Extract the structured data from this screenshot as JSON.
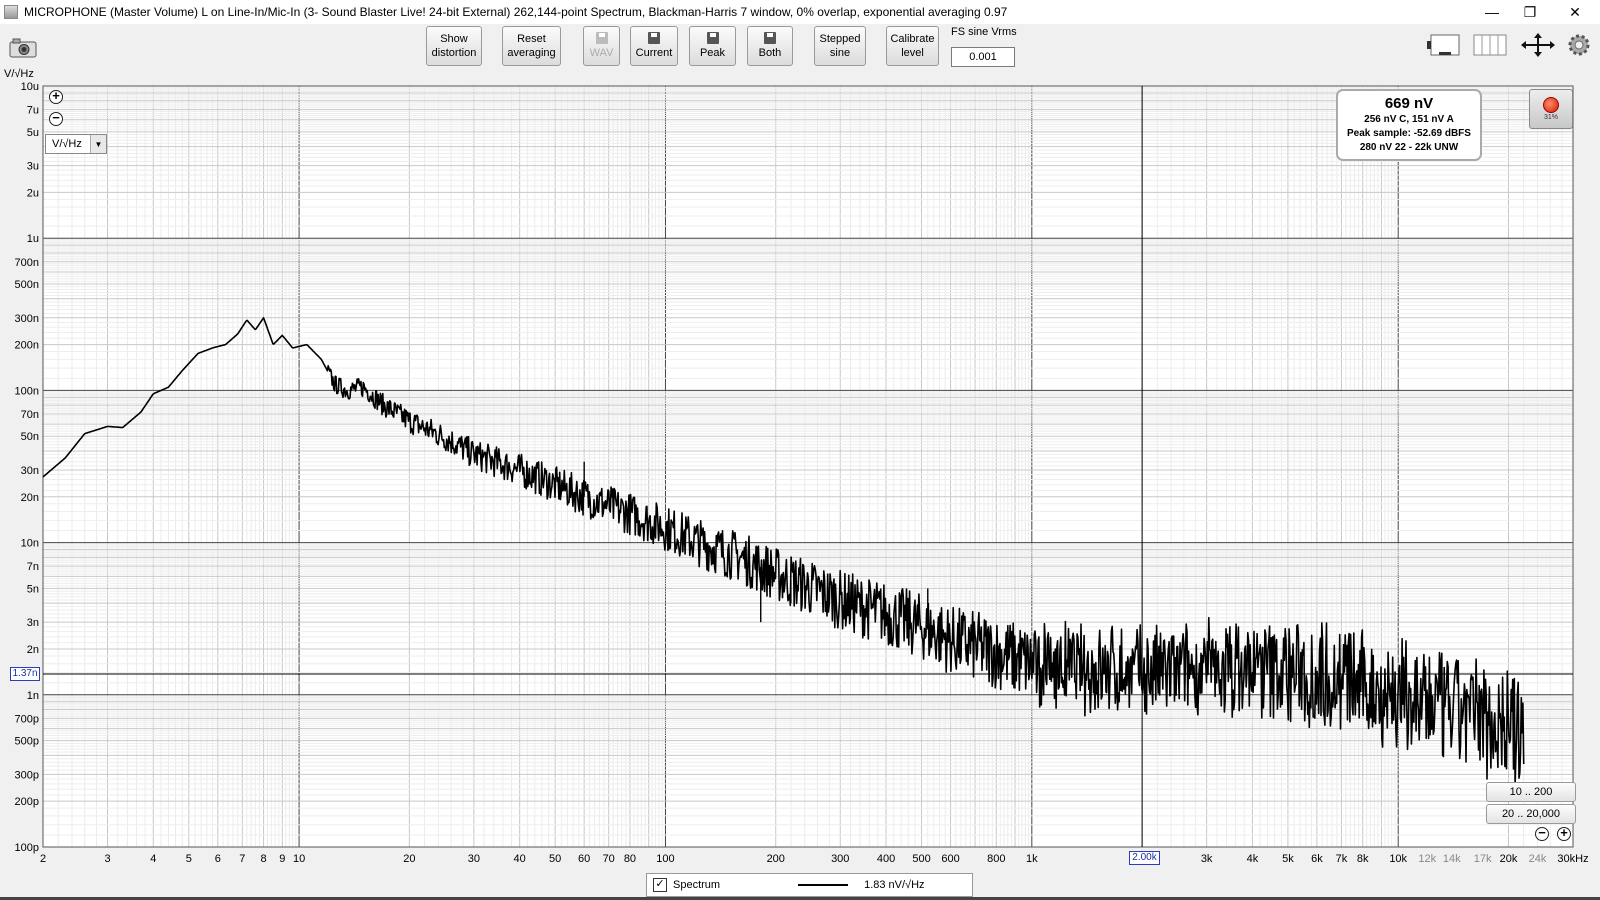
{
  "window": {
    "title": "MICROPHONE (Master Volume) L on Line-In/Mic-In (3- Sound Blaster Live! 24-bit External) 262,144-point Spectrum, Blackman-Harris 7 window, 0% overlap, exponential averaging 0.97",
    "minimize": "—",
    "restore": "❐",
    "close": "✕"
  },
  "toolbar": {
    "show_distortion": "Show\ndistortion",
    "reset_averaging": "Reset\naveraging",
    "wav": "WAV",
    "current": "Current",
    "peak": "Peak",
    "both": "Both",
    "stepped_sine": "Stepped\nsine",
    "calibrate_level": "Calibrate\nlevel",
    "fs_label": "FS sine Vrms",
    "fs_value": "0.001"
  },
  "plot": {
    "y_unit": "V/√Hz",
    "unit_selector": "V/√Hz",
    "readout": {
      "main": "669 nV",
      "line1": "256 nV C, 151 nV A",
      "line2": "Peak sample: -52.69 dBFS",
      "line3": "280 nV 22 - 22k UNW"
    },
    "rec_percent": "31%",
    "range_btn_1": "10 .. 200",
    "range_btn_2": "20 .. 20,000",
    "cursor_y": "1.37n",
    "cursor_x": "2.00k"
  },
  "legend": {
    "checked": "✓",
    "name": "Spectrum",
    "value": "1.83 nV/√Hz"
  },
  "chart_data": {
    "type": "line",
    "xscale": "log",
    "yscale": "log",
    "xlim": [
      2,
      30000
    ],
    "ylim": [
      1e-10,
      1e-05
    ],
    "xunit": "Hz",
    "yunit": "V/√Hz",
    "x_tick_labels": [
      {
        "v": 2,
        "t": "2"
      },
      {
        "v": 3,
        "t": "3"
      },
      {
        "v": 4,
        "t": "4"
      },
      {
        "v": 5,
        "t": "5"
      },
      {
        "v": 6,
        "t": "6"
      },
      {
        "v": 7,
        "t": "7"
      },
      {
        "v": 8,
        "t": "8"
      },
      {
        "v": 9,
        "t": "9"
      },
      {
        "v": 10,
        "t": "10"
      },
      {
        "v": 20,
        "t": "20"
      },
      {
        "v": 30,
        "t": "30"
      },
      {
        "v": 40,
        "t": "40"
      },
      {
        "v": 50,
        "t": "50"
      },
      {
        "v": 60,
        "t": "60"
      },
      {
        "v": 70,
        "t": "70"
      },
      {
        "v": 80,
        "t": "80"
      },
      {
        "v": 100,
        "t": "100"
      },
      {
        "v": 200,
        "t": "200"
      },
      {
        "v": 300,
        "t": "300"
      },
      {
        "v": 400,
        "t": "400"
      },
      {
        "v": 500,
        "t": "500"
      },
      {
        "v": 600,
        "t": "600"
      },
      {
        "v": 800,
        "t": "800"
      },
      {
        "v": 1000,
        "t": "1k"
      },
      {
        "v": 3000,
        "t": "3k"
      },
      {
        "v": 4000,
        "t": "4k"
      },
      {
        "v": 5000,
        "t": "5k"
      },
      {
        "v": 6000,
        "t": "6k"
      },
      {
        "v": 7000,
        "t": "7k"
      },
      {
        "v": 8000,
        "t": "8k"
      },
      {
        "v": 10000,
        "t": "10k"
      },
      {
        "v": 12000,
        "t": "12k",
        "dim": true
      },
      {
        "v": 14000,
        "t": "14k",
        "dim": true
      },
      {
        "v": 17000,
        "t": "17k",
        "dim": true
      },
      {
        "v": 20000,
        "t": "20k"
      },
      {
        "v": 24000,
        "t": "24k",
        "dim": true
      },
      {
        "v": 30000,
        "t": "30kHz"
      }
    ],
    "y_tick_labels": [
      {
        "v": 1e-05,
        "t": "10u"
      },
      {
        "v": 7e-06,
        "t": "7u"
      },
      {
        "v": 5e-06,
        "t": "5u"
      },
      {
        "v": 3e-06,
        "t": "3u"
      },
      {
        "v": 2e-06,
        "t": "2u"
      },
      {
        "v": 1e-06,
        "t": "1u"
      },
      {
        "v": 7e-07,
        "t": "700n"
      },
      {
        "v": 5e-07,
        "t": "500n"
      },
      {
        "v": 3e-07,
        "t": "300n"
      },
      {
        "v": 2e-07,
        "t": "200n"
      },
      {
        "v": 1e-07,
        "t": "100n"
      },
      {
        "v": 7e-08,
        "t": "70n"
      },
      {
        "v": 5e-08,
        "t": "50n"
      },
      {
        "v": 3e-08,
        "t": "30n"
      },
      {
        "v": 2e-08,
        "t": "20n"
      },
      {
        "v": 1e-08,
        "t": "10n"
      },
      {
        "v": 7e-09,
        "t": "7n"
      },
      {
        "v": 5e-09,
        "t": "5n"
      },
      {
        "v": 3e-09,
        "t": "3n"
      },
      {
        "v": 2e-09,
        "t": "2n"
      },
      {
        "v": 1e-09,
        "t": "1n"
      },
      {
        "v": 7e-10,
        "t": "700p"
      },
      {
        "v": 5e-10,
        "t": "500p"
      },
      {
        "v": 3e-10,
        "t": "300p"
      },
      {
        "v": 2e-10,
        "t": "200p"
      },
      {
        "v": 1e-10,
        "t": "100p"
      }
    ],
    "cursor": {
      "x": 2000,
      "y": 1.37e-09
    },
    "series": [
      {
        "color": "#000000",
        "points": [
          [
            2,
            2.7e-08
          ],
          [
            2.3,
            3.6e-08
          ],
          [
            2.6,
            5.2e-08
          ],
          [
            3,
            5.8e-08
          ],
          [
            3.3,
            5.7e-08
          ],
          [
            3.7,
            7.2e-08
          ],
          [
            4,
            9.5e-08
          ],
          [
            4.4,
            1.05e-07
          ],
          [
            4.8,
            1.35e-07
          ],
          [
            5.3,
            1.75e-07
          ],
          [
            5.8,
            1.9e-07
          ],
          [
            6.3,
            2e-07
          ],
          [
            6.8,
            2.35e-07
          ],
          [
            7.2,
            2.9e-07
          ],
          [
            7.6,
            2.5e-07
          ],
          [
            8,
            3e-07
          ],
          [
            8.5,
            2e-07
          ],
          [
            9,
            2.3e-07
          ],
          [
            9.6,
            1.9e-07
          ],
          [
            10.5,
            2e-07
          ],
          [
            11.5,
            1.6e-07
          ],
          [
            12.5,
            1.1e-07
          ],
          [
            13.5,
            1e-07
          ],
          [
            15,
            1.05e-07
          ],
          [
            17,
            8e-08
          ],
          [
            20,
            6.3e-08
          ],
          [
            25,
            4.9e-08
          ],
          [
            30,
            3.8e-08
          ],
          [
            40,
            3e-08
          ],
          [
            50,
            2.4e-08
          ],
          [
            60,
            2e-08
          ],
          [
            70,
            1.75e-08
          ],
          [
            80,
            1.55e-08
          ],
          [
            100,
            1.25e-08
          ],
          [
            130,
            9.5e-09
          ],
          [
            160,
            8e-09
          ],
          [
            200,
            6.2e-09
          ],
          [
            250,
            5e-09
          ],
          [
            300,
            4.2e-09
          ],
          [
            400,
            3.4e-09
          ],
          [
            500,
            2.8e-09
          ],
          [
            600,
            2.3e-09
          ],
          [
            800,
            1.9e-09
          ],
          [
            1000,
            1.6e-09
          ],
          [
            1300,
            1.5e-09
          ],
          [
            1600,
            1.45e-09
          ],
          [
            2000,
            1.4e-09
          ],
          [
            2500,
            1.4e-09
          ],
          [
            3000,
            1.45e-09
          ],
          [
            4000,
            1.48e-09
          ],
          [
            5000,
            1.42e-09
          ],
          [
            6000,
            1.35e-09
          ],
          [
            7000,
            1.28e-09
          ],
          [
            8000,
            1.15e-09
          ],
          [
            10000,
            1e-09
          ],
          [
            12000,
            8.8e-10
          ],
          [
            14000,
            7.8e-10
          ],
          [
            17000,
            7.2e-10
          ],
          [
            20000,
            6.5e-10
          ],
          [
            22000,
            5.5e-10
          ]
        ],
        "spikes": [
          [
            60,
            3.4e-08
          ],
          [
            182,
            3e-09
          ],
          [
            220,
            4e-09
          ],
          [
            520,
            5e-09
          ],
          [
            900,
            1.1e-09
          ]
        ]
      }
    ]
  }
}
